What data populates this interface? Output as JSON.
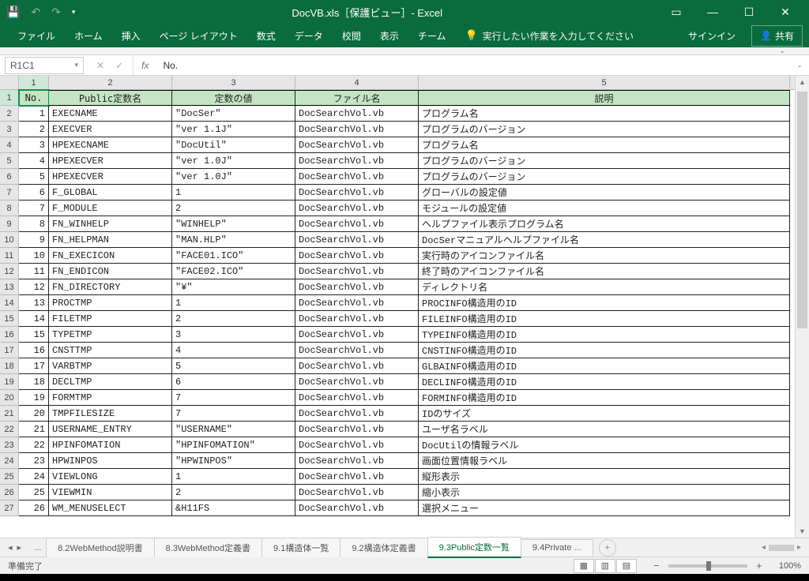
{
  "title": "DocVB.xls［保護ビュー］- Excel",
  "ribbon": {
    "file": "ファイル",
    "home": "ホーム",
    "insert": "挿入",
    "layout": "ページ レイアウト",
    "formula": "数式",
    "data": "データ",
    "review": "校閲",
    "view": "表示",
    "team": "チーム",
    "tell": "実行したい作業を入力してください",
    "signin": "サインイン",
    "share": "共有"
  },
  "namebox": "R1C1",
  "fx_value": "No.",
  "col_labels": {
    "c1": "1",
    "c2": "2",
    "c3": "3",
    "c4": "4",
    "c5": "5"
  },
  "headers": {
    "no": "No.",
    "name": "Public定数名",
    "val": "定数の値",
    "file": "ファイル名",
    "desc": "説明"
  },
  "rows": [
    {
      "no": "1",
      "name": "EXECNAME",
      "val": "\"DocSer\"",
      "file": "DocSearchVol.vb",
      "desc": "プログラム名"
    },
    {
      "no": "2",
      "name": "EXECVER",
      "val": "\"ver 1.1J\"",
      "file": "DocSearchVol.vb",
      "desc": "プログラムのバージョン"
    },
    {
      "no": "3",
      "name": "HPEXECNAME",
      "val": "\"DocUtil\"",
      "file": "DocSearchVol.vb",
      "desc": "プログラム名"
    },
    {
      "no": "4",
      "name": "HPEXECVER",
      "val": "\"ver 1.0J\"",
      "file": "DocSearchVol.vb",
      "desc": "プログラムのバージョン"
    },
    {
      "no": "5",
      "name": "HPEXECVER",
      "val": "\"ver 1.0J\"",
      "file": "DocSearchVol.vb",
      "desc": "プログラムのバージョン"
    },
    {
      "no": "6",
      "name": "F_GLOBAL",
      "val": "1",
      "file": "DocSearchVol.vb",
      "desc": "グローバルの設定値"
    },
    {
      "no": "7",
      "name": "F_MODULE",
      "val": "2",
      "file": "DocSearchVol.vb",
      "desc": "モジュールの設定値"
    },
    {
      "no": "8",
      "name": "FN_WINHELP",
      "val": "\"WINHELP\"",
      "file": "DocSearchVol.vb",
      "desc": "ヘルプファイル表示プログラム名"
    },
    {
      "no": "9",
      "name": "FN_HELPMAN",
      "val": "\"MAN.HLP\"",
      "file": "DocSearchVol.vb",
      "desc": "DocSerマニュアルヘルプファイル名"
    },
    {
      "no": "10",
      "name": "FN_EXECICON",
      "val": "\"FACE01.ICO\"",
      "file": "DocSearchVol.vb",
      "desc": "実行時のアイコンファイル名"
    },
    {
      "no": "11",
      "name": "FN_ENDICON",
      "val": "\"FACE02.ICO\"",
      "file": "DocSearchVol.vb",
      "desc": "終了時のアイコンファイル名"
    },
    {
      "no": "12",
      "name": "FN_DIRECTORY",
      "val": "\"¥\"",
      "file": "DocSearchVol.vb",
      "desc": "ディレクトリ名"
    },
    {
      "no": "13",
      "name": "PROCTMP",
      "val": "1",
      "file": "DocSearchVol.vb",
      "desc": "PROCINFO構造用のID"
    },
    {
      "no": "14",
      "name": "FILETMP",
      "val": "2",
      "file": "DocSearchVol.vb",
      "desc": "FILEINFO構造用のID"
    },
    {
      "no": "15",
      "name": "TYPETMP",
      "val": "3",
      "file": "DocSearchVol.vb",
      "desc": "TYPEINFO構造用のID"
    },
    {
      "no": "16",
      "name": "CNSTTMP",
      "val": "4",
      "file": "DocSearchVol.vb",
      "desc": "CNSTINFO構造用のID"
    },
    {
      "no": "17",
      "name": "VARBTMP",
      "val": "5",
      "file": "DocSearchVol.vb",
      "desc": "GLBAINFO構造用のID"
    },
    {
      "no": "18",
      "name": "DECLTMP",
      "val": "6",
      "file": "DocSearchVol.vb",
      "desc": "DECLINFO構造用のID"
    },
    {
      "no": "19",
      "name": "FORMTMP",
      "val": "7",
      "file": "DocSearchVol.vb",
      "desc": "FORMINFO構造用のID"
    },
    {
      "no": "20",
      "name": "TMPFILESIZE",
      "val": "7",
      "file": "DocSearchVol.vb",
      "desc": "IDのサイズ"
    },
    {
      "no": "21",
      "name": "USERNAME_ENTRY",
      "val": "\"USERNAME\"",
      "file": "DocSearchVol.vb",
      "desc": "ユーザ名ラベル"
    },
    {
      "no": "22",
      "name": "HPINFOMATION",
      "val": "\"HPINFOMATION\"",
      "file": "DocSearchVol.vb",
      "desc": "DocUtilの情報ラベル"
    },
    {
      "no": "23",
      "name": "HPWINPOS",
      "val": "\"HPWINPOS\"",
      "file": "DocSearchVol.vb",
      "desc": "画面位置情報ラベル"
    },
    {
      "no": "24",
      "name": "VIEWLONG",
      "val": "1",
      "file": "DocSearchVol.vb",
      "desc": "縦形表示"
    },
    {
      "no": "25",
      "name": "VIEWMIN",
      "val": "2",
      "file": "DocSearchVol.vb",
      "desc": "縮小表示"
    },
    {
      "no": "26",
      "name": "WM_MENUSELECT",
      "val": "&H11FS",
      "file": "DocSearchVol.vb",
      "desc": "選択メニュー"
    }
  ],
  "sheet_tabs": {
    "t1": "8.2WebMethod説明書",
    "t2": "8.3WebMethod定義書",
    "t3": "9.1構造体一覧",
    "t4": "9.2構造体定義書",
    "t5": "9.3Public定数一覧",
    "t6": "9.4Private"
  },
  "status": {
    "ready": "準備完了",
    "zoom": "100%"
  }
}
